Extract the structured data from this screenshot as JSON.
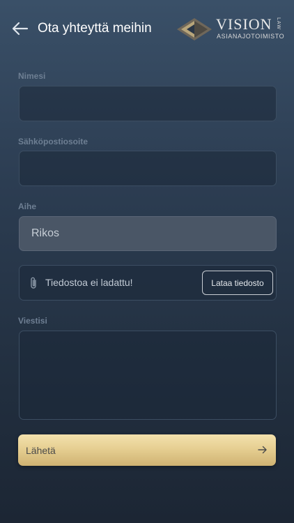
{
  "header": {
    "title": "Ota yhteyttä meihin",
    "back_icon": "arrow-left-icon"
  },
  "logo": {
    "wordmark": "VISION",
    "vertical": "LAW",
    "subtitle": "ASIANAJOTOIMISTO"
  },
  "form": {
    "name_label": "Nimesi",
    "name_value": "",
    "email_label": "Sähköpostiosoite",
    "email_value": "",
    "subject_label": "Aihe",
    "subject_value": "Rikos",
    "attachment": {
      "icon": "paperclip-icon",
      "status": "Tiedostoa ei ladattu!",
      "button_label": "Lataa tiedosto"
    },
    "message_label": "Viestisi",
    "message_value": "",
    "submit_label": "Lähetä",
    "submit_icon": "arrow-right-icon"
  },
  "colors": {
    "background_top": "#3a5068",
    "background_bottom": "#1c2634",
    "accent_gold": "#e6cf92",
    "label": "#6e7f93"
  }
}
